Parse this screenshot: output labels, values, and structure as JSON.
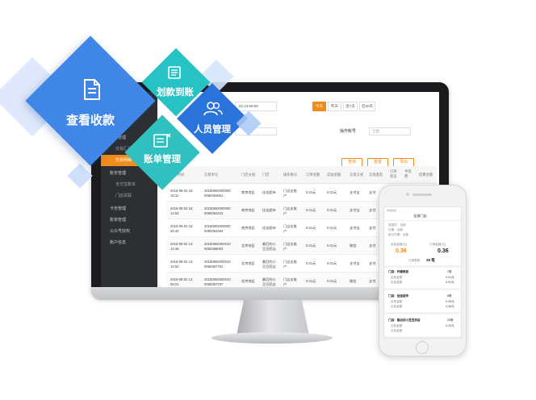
{
  "badges": {
    "view_payment": "查看收款",
    "transfer": "划款到账",
    "staff": "人员管理",
    "billing": "账单管理"
  },
  "sidebar": {
    "items": [
      {
        "label": "首页"
      },
      {
        "label": "首页功能"
      },
      {
        "label": "交易管理"
      },
      {
        "label": "交易汇总",
        "sub": true
      },
      {
        "label": "交易明细",
        "sub": true,
        "active": true
      },
      {
        "label": "账务管理"
      },
      {
        "label": "支付宝账本",
        "sub": true
      },
      {
        "label": "门店关联",
        "sub": true
      },
      {
        "label": "卡务管理"
      },
      {
        "label": "账单管理"
      },
      {
        "label": "公众号授权"
      },
      {
        "label": "账户信息"
      }
    ]
  },
  "toolbar": {
    "date": "02 23:59:59",
    "ranges": [
      "今天",
      "昨天",
      "近7天",
      "近30天"
    ],
    "operator_label": "操作账号",
    "operator_placeholder": "全部",
    "query_btn": "查询",
    "reset_btn": "重置",
    "export_btn": "导出"
  },
  "table": {
    "headers": [
      "交易时间",
      "交易单号",
      "门店分组",
      "门店",
      "操作账号",
      "订单金额",
      "实收金额",
      "交易方式",
      "交易类型",
      "订单\n状态",
      "手续\n费",
      "结算金额"
    ],
    "rows": [
      [
        "2018-08-02 16:\n10:11",
        "20180802000000\n0080354861",
        "南京地区",
        "佳佳超市",
        "门店支账\n户",
        "0.01元",
        "0.01元",
        "支付宝",
        "支付"
      ],
      [
        "2018-08-02 16:\n14:54",
        "20180802000000\n0080354423",
        "南京地区",
        "佳佳超市",
        "门店支账\n户",
        "0.01元",
        "0.01元",
        "支付宝",
        "支付"
      ],
      [
        "2018-08-02 16:\n26:42",
        "20180802000000\n0080354384",
        "南京地区",
        "佳佳超市",
        "门店支账\n户",
        "0.01元",
        "0.01元",
        "支付宝",
        "支付"
      ],
      [
        "2018-08-02 14:\n14:46",
        "20180802000010\n0080358053",
        "北京地区",
        "最后的小\n豆豆药店",
        "门店支账\n户",
        "0.01元",
        "0.01元",
        "微信",
        "支付"
      ],
      [
        "2018-08-02 14:\n12:52",
        "20180802000010\n0080387781",
        "北京地区",
        "最后的小\n豆豆药店",
        "门店支账\n户",
        "0.01元",
        "0.01元",
        "支付宝",
        "支付"
      ],
      [
        "2018-08-02 14:\n08:21",
        "20180802000010\n0080387787",
        "北京地区",
        "最后的小\n豆豆药店",
        "门店支账\n户",
        "0.01元",
        "0.01元",
        "微信",
        "支付"
      ],
      [
        "2018-08-02 14:\n44:07",
        "20180802000010\n0080383051",
        "北京地区",
        "最后的小\n豆豆药店",
        "门店支账\n户",
        "0.01元",
        "0.01元",
        "支付宝",
        "支付"
      ]
    ]
  },
  "phone": {
    "status": "中国移动",
    "title": "全部门店",
    "operator": "收银员：全部",
    "period": "日期：全部",
    "date_line": "统计日期：全部",
    "left_label": "实收金额(元)",
    "left_value": "0.36",
    "right_label": "订单金额(元)",
    "right_value": "0.36",
    "count_label": "订单笔数",
    "count_value": "29 笔",
    "shops": [
      {
        "name": "门店：柠檬家居",
        "count": "1笔",
        "l1": "应收金额",
        "v1": "0.01元",
        "l2": "实收金额",
        "v2": "0.01元"
      },
      {
        "name": "门店：佳佳超市",
        "count": "6笔",
        "l1": "应收金额",
        "v1": "0.06元",
        "l2": "实收金额",
        "v2": "0.06元"
      },
      {
        "name": "门店：最后的小豆豆药店",
        "count": "20笔",
        "l1": "应收金额",
        "v1": "0.20元",
        "l2": "实收金额",
        "v2": ""
      }
    ]
  }
}
